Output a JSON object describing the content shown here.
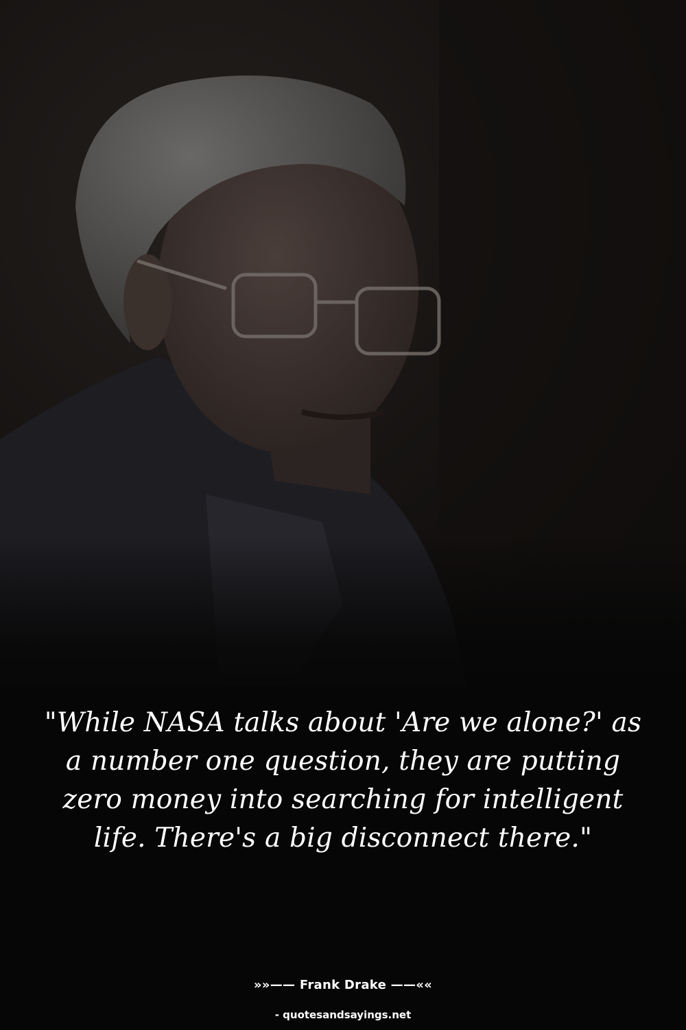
{
  "quote": {
    "text": "\"While NASA talks about 'Are we alone?' as a number one question, they are putting zero money into searching for intelligent life. There's a big disconnect there.\""
  },
  "author": {
    "line": "»»—— Frank Drake ——««"
  },
  "source": {
    "line": "- quotesandsayings.net"
  },
  "colors": {
    "background": "#060606",
    "text": "#ffffff"
  }
}
